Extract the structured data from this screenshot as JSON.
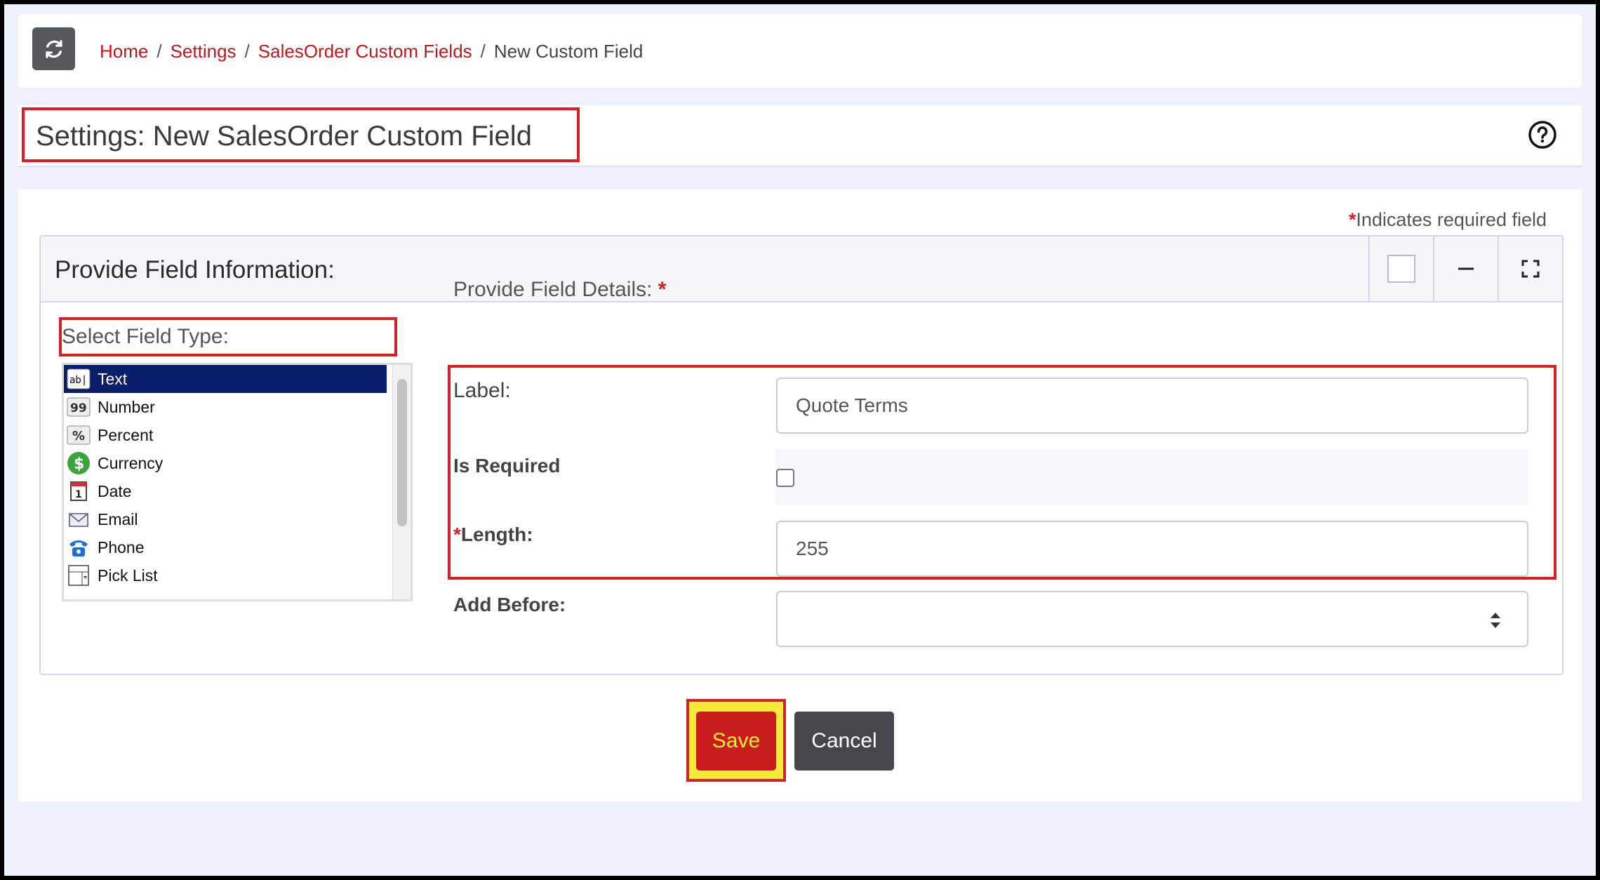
{
  "breadcrumb": {
    "home": "Home",
    "settings": "Settings",
    "custom_fields": "SalesOrder Custom Fields",
    "current": "New Custom Field",
    "separator": "/"
  },
  "header": {
    "title": "Settings: New SalesOrder Custom Field"
  },
  "form": {
    "required_note_star": "*",
    "required_note": "Indicates required field",
    "panel_title": "Provide Field Information:",
    "field_type_label": "Select Field Type:",
    "field_types": [
      {
        "label": "Text",
        "icon": "text-field-icon",
        "selected": true
      },
      {
        "label": "Number",
        "icon": "number-icon",
        "selected": false
      },
      {
        "label": "Percent",
        "icon": "percent-icon",
        "selected": false
      },
      {
        "label": "Currency",
        "icon": "currency-icon",
        "selected": false
      },
      {
        "label": "Date",
        "icon": "calendar-icon",
        "selected": false
      },
      {
        "label": "Email",
        "icon": "email-icon",
        "selected": false
      },
      {
        "label": "Phone",
        "icon": "phone-icon",
        "selected": false
      },
      {
        "label": "Pick List",
        "icon": "picklist-icon",
        "selected": false
      }
    ],
    "details_label": "Provide Field Details:",
    "details_star": "*",
    "label_field": {
      "label": "Label:",
      "value": "Quote Terms"
    },
    "is_required": {
      "label": "Is Required",
      "checked": false
    },
    "length_field": {
      "star": "*",
      "label": "Length:",
      "value": "255"
    },
    "add_before": {
      "label": "Add Before:",
      "value": ""
    }
  },
  "actions": {
    "save": "Save",
    "cancel": "Cancel"
  },
  "colors": {
    "accent_red": "#c0171e",
    "selected_bg": "#0a1f6b",
    "highlight": "#f6ea3a"
  }
}
